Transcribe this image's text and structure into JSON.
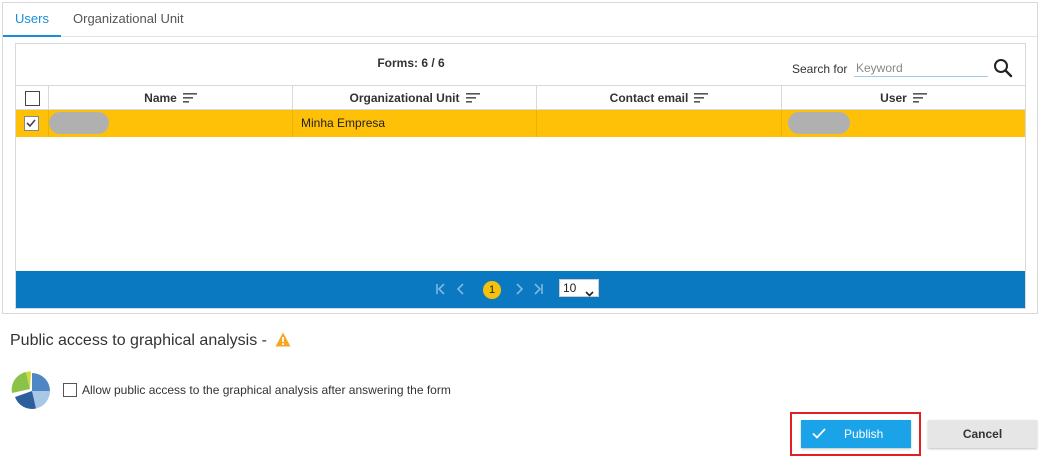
{
  "tabs": [
    {
      "label": "Users",
      "active": true
    },
    {
      "label": "Organizational Unit",
      "active": false
    }
  ],
  "grid": {
    "forms_count": "Forms: 6 / 6",
    "search_label": "Search for",
    "search_placeholder": "Keyword",
    "search_value": "",
    "columns": [
      "Name",
      "Organizational Unit",
      "Contact email",
      "User"
    ],
    "rows": [
      {
        "selected": true,
        "name": "",
        "organizational_unit": "Minha Empresa",
        "contact_email": "",
        "user": ""
      }
    ]
  },
  "pager": {
    "current_page": "1",
    "page_size": "10"
  },
  "public_access": {
    "title": "Public access to graphical analysis -",
    "allow_label": "Allow public access to the graphical analysis after answering the form",
    "allow_checked": false
  },
  "actions": {
    "publish_label": "Publish",
    "cancel_label": "Cancel"
  },
  "colors": {
    "accent": "#1a8fd6",
    "selected_row": "#ffc107",
    "pager_bar": "#0a79c2",
    "publish_button": "#1aa3e8",
    "highlight_frame": "#e31e24",
    "warning": "#f5a623"
  },
  "icons": [
    "search-icon",
    "sort-icon",
    "first-page-icon",
    "prev-page-icon",
    "next-page-icon",
    "last-page-icon",
    "warning-icon",
    "graphical-analysis-icon",
    "check-icon"
  ]
}
